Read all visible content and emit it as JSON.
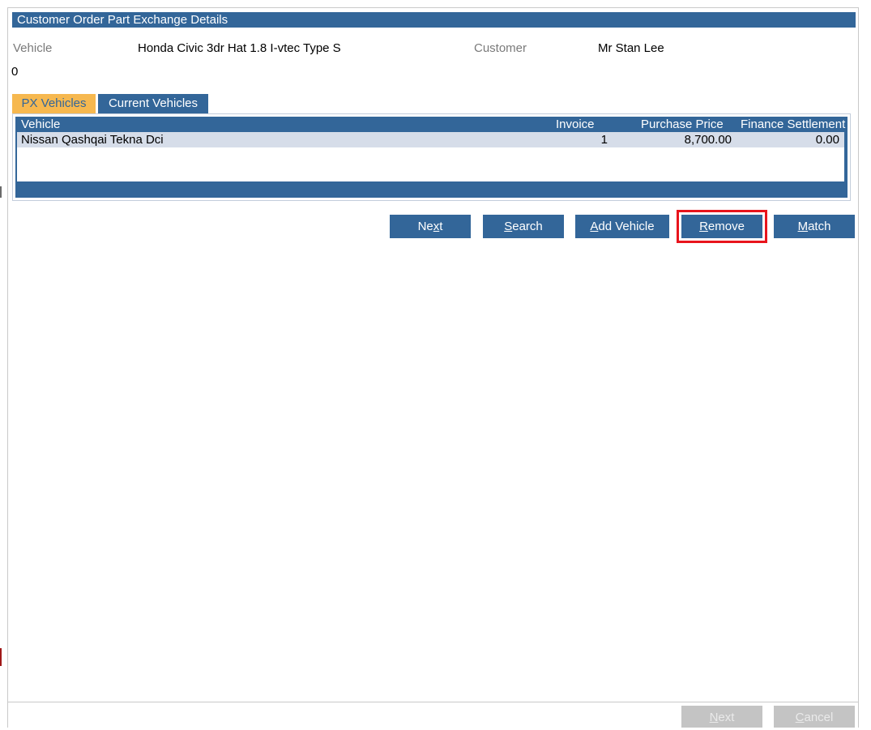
{
  "panel": {
    "title": "Customer Order Part Exchange Details"
  },
  "details": {
    "vehicle_label": "Vehicle",
    "vehicle_value": "Honda Civic 3dr Hat 1.8 I-vtec Type S",
    "customer_label": "Customer",
    "customer_value": "Mr Stan Lee",
    "stray_value": "0"
  },
  "tabs": [
    {
      "label": "PX Vehicles",
      "active": true
    },
    {
      "label": "Current Vehicles",
      "active": false
    }
  ],
  "grid": {
    "columns": [
      "Vehicle",
      "Invoice",
      "Purchase Price",
      "Finance Settlement"
    ],
    "rows": [
      {
        "vehicle": "Nissan Qashqai Tekna Dci",
        "invoice": "1",
        "purchase_price": "8,700.00",
        "finance_settlement": "0.00"
      }
    ]
  },
  "actions": {
    "next": {
      "pre": "Ne",
      "key": "x",
      "post": "t"
    },
    "search": {
      "pre": "",
      "key": "S",
      "post": "earch"
    },
    "add_vehicle": {
      "pre": "",
      "key": "A",
      "post": "dd Vehicle"
    },
    "remove": {
      "pre": "",
      "key": "R",
      "post": "emove"
    },
    "match": {
      "pre": "",
      "key": "M",
      "post": "atch"
    }
  },
  "footer": {
    "next": {
      "pre": "",
      "key": "N",
      "post": "ext"
    },
    "cancel": {
      "pre": "",
      "key": "C",
      "post": "ancel"
    }
  },
  "colors": {
    "header_blue": "#336699",
    "active_tab": "#f6b84f",
    "row_selected": "#d6dde9",
    "highlight_red": "#e8141c",
    "disabled_button": "#c4c4c4"
  }
}
